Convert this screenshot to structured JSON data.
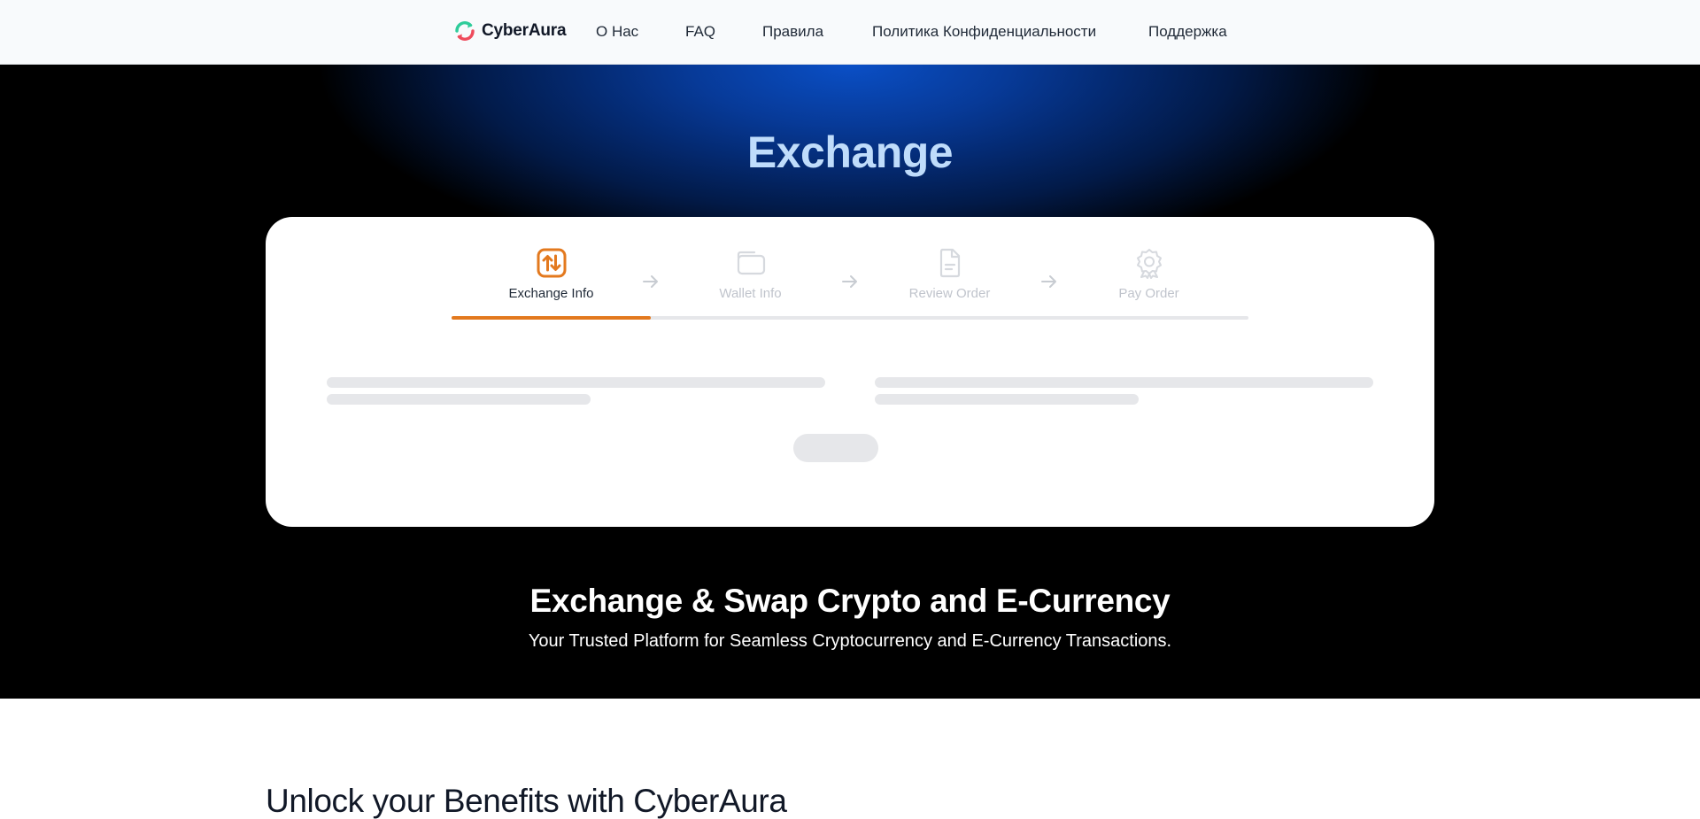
{
  "brand": {
    "name": "CyberAura",
    "logo_icon": "refresh-arrows-icon"
  },
  "nav": {
    "items": [
      {
        "label": "О Нас"
      },
      {
        "label": "FAQ"
      },
      {
        "label": "Правила"
      },
      {
        "label": "Политика Конфиденциальности"
      },
      {
        "label": "Поддержка"
      }
    ]
  },
  "hero": {
    "title": "Exchange"
  },
  "steps": {
    "items": [
      {
        "label": "Exchange Info",
        "icon": "swap-arrows-icon",
        "active": true
      },
      {
        "label": "Wallet Info",
        "icon": "wallet-icon",
        "active": false
      },
      {
        "label": "Review Order",
        "icon": "document-icon",
        "active": false
      },
      {
        "label": "Pay Order",
        "icon": "award-badge-icon",
        "active": false
      }
    ],
    "progress_fraction": 0.25
  },
  "tagline": {
    "title": "Exchange & Swap Crypto and E-Currency",
    "subtitle": "Your Trusted Platform for Seamless Cryptocurrency and E-Currency Transactions."
  },
  "benefits": {
    "title": "Unlock your Benefits with CyberAura"
  },
  "colors": {
    "accent": "#e3791e",
    "hero_title": "#bfdcfb",
    "hero_glow": "#0a4fc6",
    "skeleton": "#e6e7ea"
  }
}
